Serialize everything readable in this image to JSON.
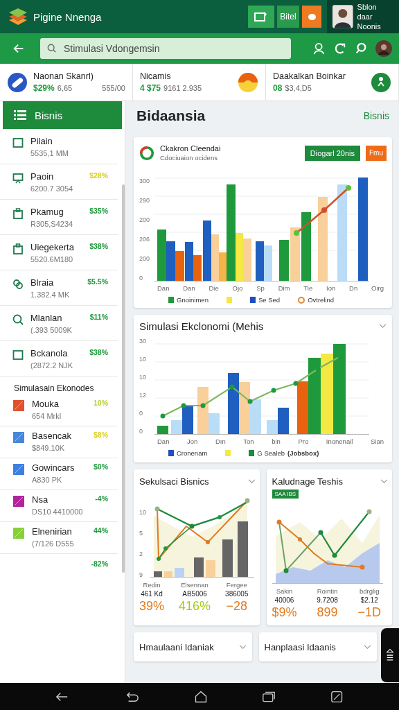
{
  "app_bar": {
    "title": "Pigine Nnenga",
    "action_label": "Bitel",
    "user": {
      "line_1": "Sblon daar",
      "line_2": "Noonis"
    }
  },
  "search": {
    "placeholder": "Stimulasi Vdongemsin"
  },
  "summary": [
    {
      "title": "Naonan Skanrl)",
      "value": "$29%",
      "detail": "6,65",
      "extra": "555/00"
    },
    {
      "title": "Nicamis",
      "value": "4 $75",
      "detail": "9161 2.935"
    },
    {
      "title": "Daakalkan Boinkar",
      "value": "08",
      "detail": "$3,4,D5"
    }
  ],
  "sidebar": {
    "header": "Bisnis",
    "items": [
      {
        "name": "Pilain",
        "detail": "5535,1 MM"
      },
      {
        "name": "Paoin",
        "detail": "6200.7 3054",
        "change": {
          "text": "$28%",
          "color": "#d9d21e"
        }
      },
      {
        "name": "Pkamug",
        "detail": "R305,S4234",
        "change": {
          "text": "$35%",
          "color": "#1e9a3c"
        }
      },
      {
        "name": "Uiegekerta",
        "detail": "5520.6M180",
        "change": {
          "text": "$38%",
          "color": "#1e9a3c"
        }
      },
      {
        "name": "Blraia",
        "detail": "1.382.4 MK",
        "change": {
          "text": "$5.5%",
          "color": "#1e9a3c"
        }
      },
      {
        "name": "Mlanlan",
        "detail": "(.393 5009K",
        "change": {
          "text": "$11%",
          "color": "#1e9a3c"
        }
      },
      {
        "name": "Bckanola",
        "detail": "(2872.2 NJK",
        "change": {
          "text": "$38%",
          "color": "#1e9a3c"
        }
      }
    ],
    "section": {
      "title": "Simulasain Ekonodes",
      "items": [
        {
          "name": "Mouka",
          "detail": "654 Mrkl",
          "color": "#e0522f",
          "change": {
            "text": "10%",
            "color": "#b5d133"
          }
        },
        {
          "name": "Basencak",
          "detail": "$849.10K",
          "color": "#4a86d8",
          "change": {
            "text": "$8%",
            "color": "#dccf2a"
          }
        },
        {
          "name": "Gowincars",
          "detail": "A830 PK",
          "color": "#3f7fe0",
          "change": {
            "text": "$0%",
            "color": "#1e9a3c"
          }
        },
        {
          "name": "Nsa",
          "detail": "DS10 4410000",
          "color": "#b0269a",
          "change": {
            "text": "-4%",
            "color": "#1e9a3c"
          }
        },
        {
          "name": "Elnenirian",
          "detail": "(7/126 D555",
          "color": "#86d13a",
          "change": {
            "text": "44%",
            "color": "#1e9a3c"
          }
        }
      ]
    },
    "footer_change": "-82%"
  },
  "main": {
    "heading": "Bidaansia",
    "link": "Bisnis"
  },
  "chart_card": {
    "title": "Ckakron Cleendai",
    "subtitle": "Cdociuaion ocidens",
    "primary_button": "Diogarl 20nis",
    "secondary_button": "Fmu",
    "y_labels": [
      "300",
      "290",
      "200",
      "206",
      "200",
      "0"
    ],
    "x_labels": [
      "Dan",
      "Dan",
      "Die",
      "Ojo",
      "Sp",
      "Dim",
      "Tie",
      "Ion",
      "Dn",
      "Oirg"
    ],
    "legend": [
      {
        "kind": "square",
        "label": "Gnoinimen",
        "color": "#1e9a3c"
      },
      {
        "kind": "square",
        "color": "#f4e842"
      },
      {
        "kind": "square",
        "label": "Se Sed",
        "color": "#1f4fbf"
      },
      {
        "kind": "ring",
        "label": "Ovtrelind",
        "color": "#e8862f"
      }
    ]
  },
  "sim_card": {
    "title": "Simulasi Ekclonomi (Mehis",
    "y_labels": [
      "30",
      "10",
      "10",
      "12",
      "0",
      "0"
    ],
    "x_labels": [
      "Dan",
      "Jon",
      "Dın",
      "Ton",
      "bin",
      "Pro",
      "Inonenail",
      "Sian"
    ],
    "legend": [
      {
        "kind": "square",
        "label": "Cronenam",
        "color": "#1f4fbf"
      },
      {
        "kind": "square",
        "color": "#f4e842"
      },
      {
        "kind": "square",
        "label": "G Sealeb",
        "color": "#1e8a3c"
      },
      {
        "kind": "text",
        "label": "(Jobsbox)"
      }
    ]
  },
  "mini_cards": [
    {
      "kind": "bar-line",
      "title": "Sekulsaci Bisnics",
      "y_labels": [
        "10",
        "5",
        "2",
        "9"
      ],
      "stats": [
        {
          "label": "Redin",
          "value": "461 Kd",
          "change": "39%",
          "color": "#e07b1f"
        },
        {
          "label": "Elsennan",
          "value": "AB5006",
          "change": "416%",
          "color": "#a6cc1c"
        },
        {
          "label": "Fergee",
          "value": "386005",
          "change": "−28",
          "color": "#e07b1f"
        }
      ]
    },
    {
      "kind": "area-line",
      "title": "Kaludnage Teshis",
      "badge": "SAA IBS",
      "stats": [
        {
          "label": "Sakin",
          "value": "40006",
          "change": "$9%",
          "color": "#e07b1f"
        },
        {
          "label": "Rointin",
          "value": "9.7208",
          "change": "899",
          "color": "#e07b1f"
        },
        {
          "label": "bdrglig",
          "value": "$2.12",
          "change": "−1D",
          "color": "#e07b1f"
        }
      ]
    }
  ],
  "bottom_cards": [
    {
      "title": "Hmaulaani Idaniak"
    },
    {
      "title": "Hanplaasi Idaanis"
    }
  ]
}
